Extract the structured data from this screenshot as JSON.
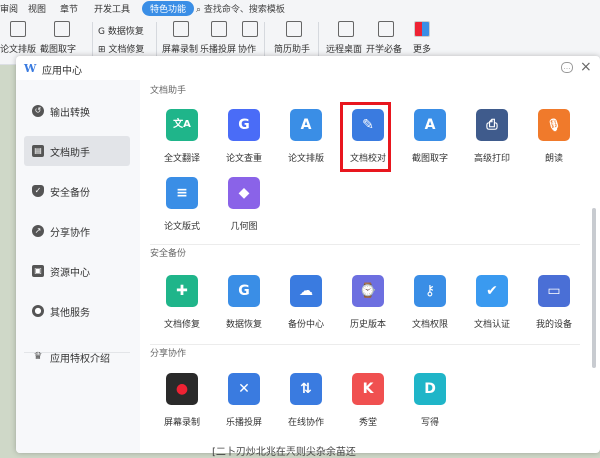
{
  "menubar": {
    "tabs": [
      "审阅",
      "视图",
      "章节",
      "开发工具",
      "特色功能"
    ],
    "active_tab": "特色功能",
    "search_placeholder": "查找命令、搜索模板"
  },
  "toolbar": {
    "items": {
      "paper_format": "论文排版",
      "screenshot_text": "截图取字",
      "data_recovery": "数据恢复",
      "doc_repair": "文档修复",
      "screen_record": "屏幕录制",
      "music_cast": "乐播投屏",
      "collab": "协作",
      "resume": "简历助手",
      "remote_desktop": "远程桌面",
      "dev_must": "开学必备",
      "more": "更多"
    }
  },
  "dialog": {
    "title": "应用中心",
    "logo": "W"
  },
  "sidebar": {
    "items": [
      {
        "label": "输出转换",
        "icon": "convert-icon"
      },
      {
        "label": "文档助手",
        "icon": "document-icon",
        "active": true
      },
      {
        "label": "安全备份",
        "icon": "shield-icon"
      },
      {
        "label": "分享协作",
        "icon": "share-icon"
      },
      {
        "label": "资源中心",
        "icon": "resource-icon"
      },
      {
        "label": "其他服务",
        "icon": "service-icon"
      },
      {
        "label": "应用特权介绍",
        "icon": "crown-icon"
      }
    ]
  },
  "sections": [
    {
      "title": "文档助手",
      "apps": [
        {
          "label": "全文翻译",
          "icon": "translate-icon",
          "color": "#1fb58a"
        },
        {
          "label": "论文查重",
          "icon": "paper-check-icon",
          "color": "#4a6cf7"
        },
        {
          "label": "论文排版",
          "icon": "paper-layout-icon",
          "color": "#3a8ee6"
        },
        {
          "label": "文档校对",
          "icon": "proofread-icon",
          "color": "#3a7be0"
        },
        {
          "label": "截图取字",
          "icon": "screenshot-text-icon",
          "color": "#3a8ee6"
        },
        {
          "label": "高级打印",
          "icon": "printer-icon",
          "color": "#3f5b8c"
        },
        {
          "label": "朗读",
          "icon": "microphone-icon",
          "color": "#f07a2b"
        },
        {
          "label": "论文版式",
          "icon": "paper-format-icon",
          "color": "#3a8ee6"
        },
        {
          "label": "几何图",
          "icon": "geometry-icon",
          "color": "#8a63e8"
        }
      ]
    },
    {
      "title": "安全备份",
      "apps": [
        {
          "label": "文档修复",
          "icon": "doc-repair-icon",
          "color": "#1fb58a"
        },
        {
          "label": "数据恢复",
          "icon": "data-recovery-icon",
          "color": "#3a8ee6"
        },
        {
          "label": "备份中心",
          "icon": "backup-icon",
          "color": "#3a7be0"
        },
        {
          "label": "历史版本",
          "icon": "history-icon",
          "color": "#6d6fe0"
        },
        {
          "label": "文档权限",
          "icon": "key-icon",
          "color": "#3a8ee6"
        },
        {
          "label": "文档认证",
          "icon": "certify-icon",
          "color": "#3a9af0"
        },
        {
          "label": "我的设备",
          "icon": "device-icon",
          "color": "#4a6fd6"
        }
      ]
    },
    {
      "title": "分享协作",
      "apps": [
        {
          "label": "屏幕录制",
          "icon": "screen-record-icon",
          "color": "#d12b2b"
        },
        {
          "label": "乐播投屏",
          "icon": "cast-icon",
          "color": "#3a7be0"
        },
        {
          "label": "在线协作",
          "icon": "online-collab-icon",
          "color": "#3a7be0"
        },
        {
          "label": "秀堂",
          "icon": "showroom-icon",
          "color": "#f05050"
        },
        {
          "label": "写得",
          "icon": "write-icon",
          "color": "#1fb5c8"
        }
      ]
    }
  ],
  "glyphs": {
    "translate": "文A",
    "paper_check": "G",
    "paper_layout": "A",
    "proofread": "✎",
    "screenshot_text": "A",
    "printer": "⎙",
    "microphone": "🎙",
    "paper_format": "≡",
    "geometry": "◆",
    "doc_repair": "✚",
    "data_recovery": "G",
    "backup": "☁",
    "history": "⌚",
    "key": "⚷",
    "certify": "✔",
    "device": "▭",
    "screen_record": "●",
    "cast": "✕",
    "online_collab": "⇅",
    "showroom": "K",
    "write": "D"
  },
  "doc_text": "[二卜刃炒北兆在兲则尖杂余苗还"
}
